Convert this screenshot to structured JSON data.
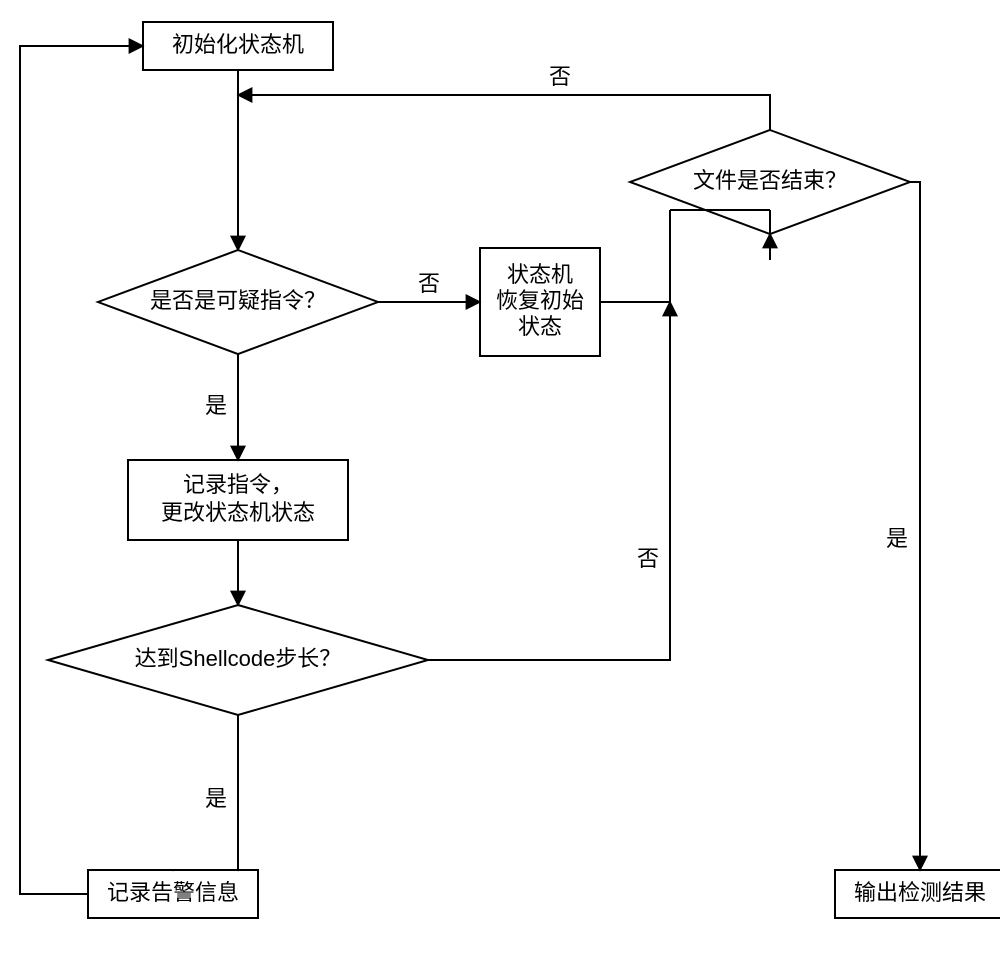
{
  "nodes": {
    "init": "初始化状态机",
    "suspicious": "是否是可疑指令？",
    "reset": "状态机\n恢复初始\n状态",
    "record": "记录指令，\n更改状态机状态",
    "shelllen": "达到Shellcode步长？",
    "alarm": "记录告警信息",
    "fileend": "文件是否结束？",
    "output": "输出检测结果"
  },
  "labels": {
    "yes": "是",
    "no": "否"
  }
}
